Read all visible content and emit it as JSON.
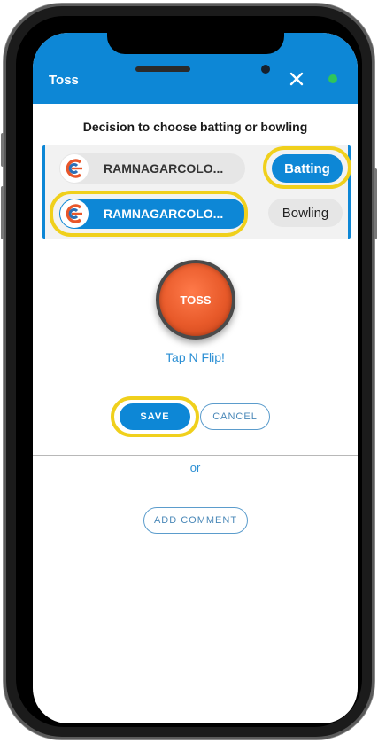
{
  "header": {
    "title": "Toss",
    "close_icon": "close-icon",
    "status_color": "#2fc55b",
    "accent": "#0d87d6"
  },
  "toss": {
    "decision_prompt": "Decision to choose batting or bowling",
    "teams": [
      {
        "name": "RAMNAGARCOLO...",
        "selected": false,
        "logo_icon": "team-logo-icon"
      },
      {
        "name": "RAMNAGARCOLO...",
        "selected": true,
        "logo_icon": "team-logo-icon"
      }
    ],
    "choices": [
      {
        "label": "Batting",
        "selected": true
      },
      {
        "label": "Bowling",
        "selected": false
      }
    ],
    "coin_label": "TOSS",
    "tap_hint": "Tap N Flip!"
  },
  "actions": {
    "save_label": "SAVE",
    "cancel_label": "CANCEL",
    "or_label": "or",
    "add_comment_label": "ADD COMMENT"
  },
  "highlight_color": "#f0d01c"
}
